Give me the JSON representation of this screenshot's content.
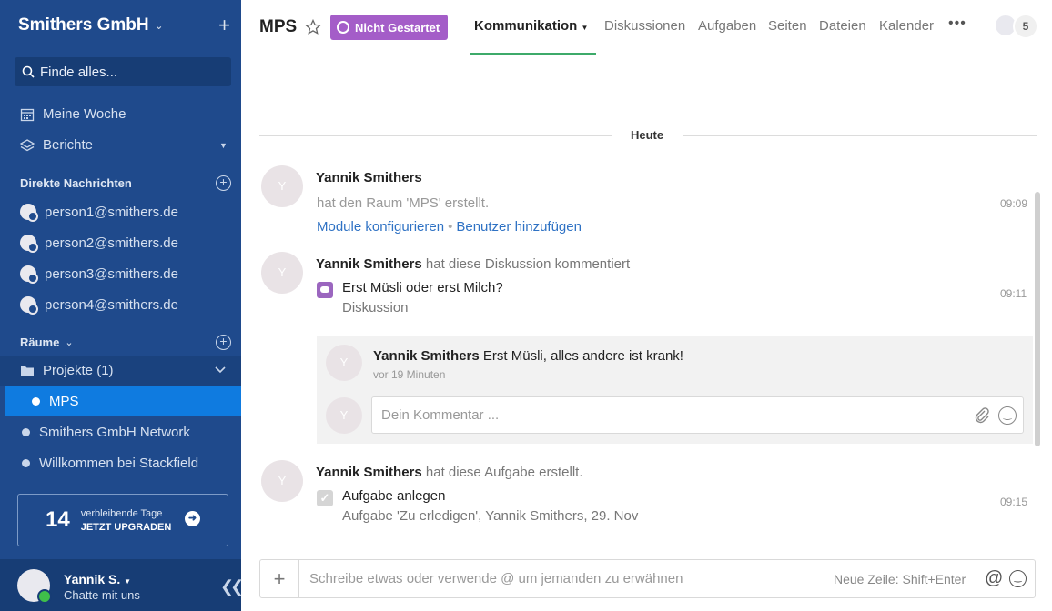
{
  "sidebar": {
    "workspace": "Smithers GmbH",
    "search_placeholder": "Finde alles...",
    "nav": [
      {
        "label": "Meine Woche",
        "icon": "calendar-icon"
      },
      {
        "label": "Berichte",
        "icon": "layers-icon"
      }
    ],
    "direct_messages": {
      "heading": "Direkte Nachrichten",
      "items": [
        "person1@smithers.de",
        "person2@smithers.de",
        "person3@smithers.de",
        "person4@smithers.de"
      ]
    },
    "rooms": {
      "heading": "Räume",
      "group": "Projekte (1)",
      "active": "MPS",
      "items": [
        "Smithers GmbH Network",
        "Willkommen bei Stackfield"
      ]
    },
    "upgrade": {
      "days": "14",
      "line1": "verbleibende Tage",
      "line2": "JETZT UPGRADEN"
    },
    "user": {
      "name": "Yannik S.",
      "status": "Chatte mit uns"
    }
  },
  "header": {
    "title": "MPS",
    "status_badge": "Nicht Gestartet",
    "tabs": [
      "Kommunikation",
      "Diskussionen",
      "Aufgaben",
      "Seiten",
      "Dateien",
      "Kalender"
    ],
    "active_tab": "Kommunikation",
    "member_count": "5"
  },
  "feed": {
    "day_label": "Heute",
    "entries": [
      {
        "author": "Yannik Smithers",
        "avatar": "Y",
        "text": "hat den Raum 'MPS' erstellt.",
        "time": "09:09",
        "links": [
          "Module konfigurieren",
          "Benutzer hinzufügen"
        ]
      },
      {
        "author": "Yannik Smithers",
        "avatar": "Y",
        "action": "hat diese Diskussion kommentiert",
        "item_title": "Erst Müsli oder erst Milch?",
        "item_type": "Diskussion",
        "time": "09:11",
        "comment": {
          "author": "Yannik Smithers",
          "text": "Erst Müsli, alles andere ist krank!",
          "time_ago": "vor 19 Minuten"
        },
        "comment_placeholder": "Dein Kommentar ..."
      },
      {
        "author": "Yannik Smithers",
        "avatar": "Y",
        "action": "hat diese Aufgabe erstellt.",
        "item_title": "Aufgabe anlegen",
        "item_sub": "Aufgabe 'Zu erledigen', Yannik Smithers, 29. Nov",
        "time": "09:15"
      }
    ]
  },
  "composer": {
    "placeholder": "Schreibe etwas oder verwende @ um jemanden zu erwähnen",
    "hint": "Neue Zeile: Shift+Enter"
  },
  "colors": {
    "sidebar": "#1f4a8c",
    "active_room": "#0f7be0",
    "status_badge": "#a45dc8",
    "tab_underline": "#3daa6a",
    "link": "#2f72c4"
  }
}
